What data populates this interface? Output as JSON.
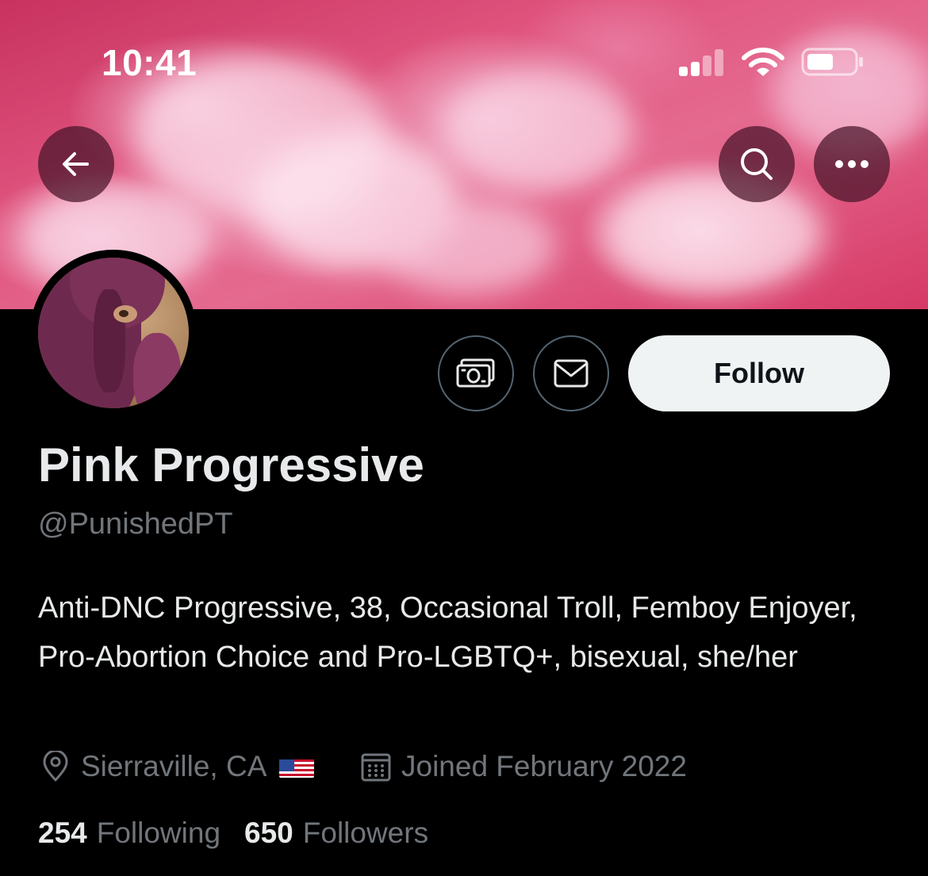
{
  "status_bar": {
    "time": "10:41"
  },
  "header": {
    "back_icon": "arrow-left-icon",
    "search_icon": "search-icon",
    "more_icon": "more-horizontal-icon",
    "banner_color": "#e0557f"
  },
  "actions": {
    "tip_icon": "money-icon",
    "message_icon": "envelope-icon",
    "follow_label": "Follow"
  },
  "profile": {
    "display_name": "Pink Progressive",
    "handle": "@PunishedPT",
    "bio": "Anti-DNC Progressive, 38, Occasional Troll, Femboy Enjoyer, Pro-Abortion Choice and Pro-LGBTQ+, bisexual, she/her",
    "location": "Sierraville, CA",
    "location_flag": "🇺🇸",
    "joined": "Joined February 2022"
  },
  "stats": {
    "following_count": "254",
    "following_label": "Following",
    "followers_count": "650",
    "followers_label": "Followers"
  },
  "colors": {
    "background": "#000000",
    "primary_text": "#e7e9ea",
    "secondary_text": "#71767b",
    "follow_button_bg": "#eff3f4"
  }
}
